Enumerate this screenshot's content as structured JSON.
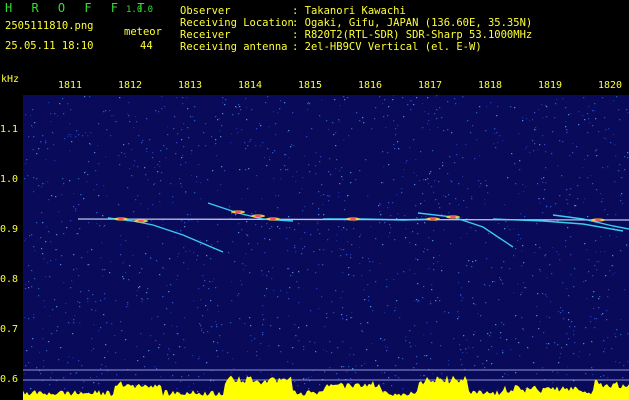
{
  "header": {
    "logo": "H R O F F T",
    "version": "1.0.0",
    "filename": "2505111810.png",
    "datetime": "25.05.11 18:10",
    "meteor_label": "meteor",
    "meteor_count": "44"
  },
  "info": {
    "observer_label": "Observer",
    "observer_value": ": Takanori Kawachi",
    "location_label": "Receiving Location",
    "location_value": ": Ogaki, Gifu, JAPAN (136.60E, 35.35N)",
    "receiver_label": "Receiver",
    "receiver_value": ": R820T2(RTL-SDR) SDR-Sharp 53.1000MHz",
    "antenna_label": "Receiving antenna",
    "antenna_value": ": 2el-HB9CV Vertical (el. E-W)"
  },
  "spectrogram": {
    "y_unit": "kHz",
    "x_ticks": [
      "1811",
      "1812",
      "1813",
      "1814",
      "1815",
      "1816",
      "1817",
      "1818",
      "1819",
      "1820"
    ],
    "y_ticks": [
      "1.1",
      "1.0",
      "0.9",
      "0.8",
      "0.7",
      "0.6"
    ],
    "colors": {
      "background": "#0a0a5a",
      "carrier": "#d8e8ff",
      "echo_hot": "#ff5060",
      "echo_warm": "#ffd040",
      "echo_cool": "#40e0ff",
      "level": "#ffff00"
    }
  }
}
